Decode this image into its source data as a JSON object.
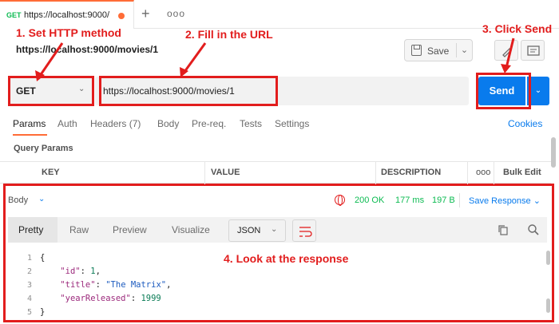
{
  "tab": {
    "method": "GET",
    "title": "https://localhost:9000/",
    "plus": "+",
    "more": "ooo"
  },
  "request": {
    "title": "https://localhost:9000/movies/1",
    "save_label": "Save",
    "method": "GET",
    "url": "https://localhost:9000/movies/1",
    "send_label": "Send"
  },
  "annotations": {
    "step1": "1. Set HTTP method",
    "step2": "2. Fill in the URL",
    "step3": "3. Click Send",
    "step4": "4. Look at the response",
    "color": "#e21d1d"
  },
  "request_tabs": [
    {
      "label": "Params",
      "active": true
    },
    {
      "label": "Auth"
    },
    {
      "label": "Headers (7)"
    },
    {
      "label": "Body"
    },
    {
      "label": "Pre-req."
    },
    {
      "label": "Tests"
    },
    {
      "label": "Settings"
    }
  ],
  "cookies_label": "Cookies",
  "query_params_label": "Query Params",
  "params_table": {
    "headers": [
      "KEY",
      "VALUE",
      "DESCRIPTION"
    ],
    "more": "ooo",
    "bulk_edit": "Bulk Edit"
  },
  "response": {
    "body_label": "Body",
    "status": "200 OK",
    "time": "177 ms",
    "size": "197 B",
    "save_response": "Save Response",
    "view_tabs": [
      "Pretty",
      "Raw",
      "Preview",
      "Visualize"
    ],
    "format": "JSON",
    "line_numbers": [
      "1",
      "2",
      "3",
      "4",
      "5"
    ],
    "json": {
      "id": 1,
      "title": "The Matrix",
      "yearReleased": 1999
    }
  },
  "colors": {
    "accent": "#ff6c37",
    "send": "#097bed",
    "success": "#0cbb52"
  }
}
